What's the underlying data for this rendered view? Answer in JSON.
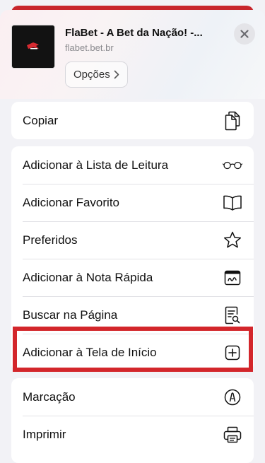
{
  "header": {
    "site_title": "FlaBet - A Bet da Nação! -...",
    "site_url": "flabet.bet.br",
    "options_label": "Opções",
    "options_chevron": "chevron-right-icon",
    "close_icon": "close-icon"
  },
  "groups": [
    {
      "items": [
        {
          "label": "Copiar",
          "icon": "copy-icon"
        }
      ]
    },
    {
      "items": [
        {
          "label": "Adicionar à Lista de Leitura",
          "icon": "glasses-icon"
        },
        {
          "label": "Adicionar Favorito",
          "icon": "book-icon"
        },
        {
          "label": "Preferidos",
          "icon": "star-icon"
        },
        {
          "label": "Adicionar à Nota Rápida",
          "icon": "quick-note-icon"
        },
        {
          "label": "Buscar na Página",
          "icon": "find-in-page-icon"
        },
        {
          "label": "Adicionar à Tela de Início",
          "icon": "add-square-icon",
          "highlighted": true
        }
      ]
    },
    {
      "items": [
        {
          "label": "Marcação",
          "icon": "markup-icon"
        },
        {
          "label": "Imprimir",
          "icon": "printer-icon"
        }
      ]
    }
  ],
  "colors": {
    "highlight": "#d3262b",
    "peek_bar": "#c8262c",
    "background": "#f2f2f6"
  }
}
